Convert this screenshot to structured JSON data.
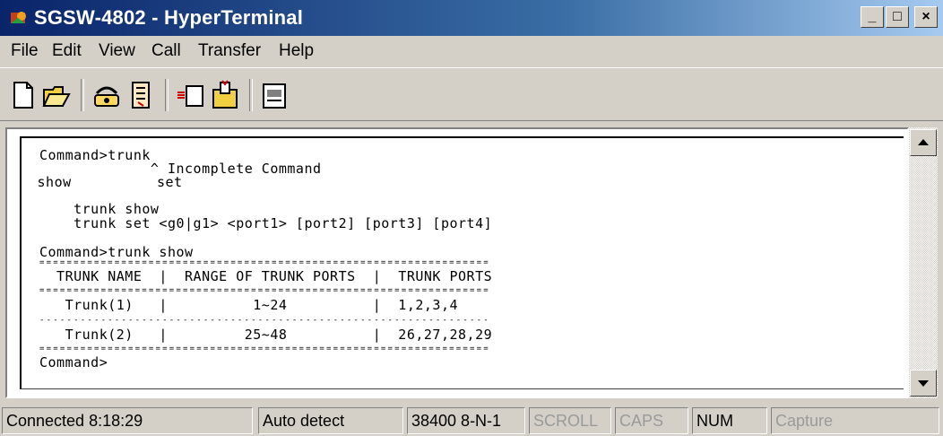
{
  "window": {
    "title": "SGSW-4802 - HyperTerminal"
  },
  "menu": [
    "File",
    "Edit",
    "View",
    "Call",
    "Transfer",
    "Help"
  ],
  "toolbar": {
    "icons": [
      "new-icon",
      "open-icon",
      "connect-icon",
      "disconnect-icon",
      "send-icon",
      "receive-icon",
      "properties-icon"
    ]
  },
  "terminal": {
    "lines": [
      "Command>trunk",
      "             ^ Incomplete Command",
      " show          set",
      "    trunk show",
      "    trunk set <g0|g1> <port1> [port2] [port3] [port4]",
      "Command>trunk show",
      "==================================================================",
      "  TRUNK NAME  |  RANGE OF TRUNK PORTS  |  TRUNK PORTS",
      "==================================================================",
      "   Trunk(1)   |          1~24          |  1,2,3,4",
      "------------------------------------------------------------------",
      "   Trunk(2)   |         25~48          |  26,27,28,29",
      "==================================================================",
      "Command>"
    ]
  },
  "status": {
    "connected": "Connected 8:18:29",
    "detect": "Auto detect",
    "settings": "38400 8-N-1",
    "scroll": "SCROLL",
    "caps": "CAPS",
    "num": "NUM",
    "capture": "Capture"
  }
}
